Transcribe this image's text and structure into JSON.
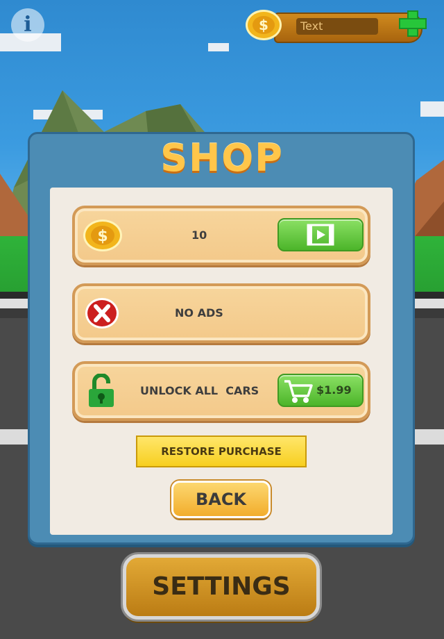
{
  "hud": {
    "currency_text": "Text",
    "info_symbol": "i",
    "coin_symbol": "$"
  },
  "shop": {
    "title": "SHOP",
    "items": [
      {
        "label": "10",
        "icon": "coin-icon",
        "action_icon": "video-play-icon"
      },
      {
        "label": "NO ADS",
        "icon": "no-ads-x-icon"
      },
      {
        "label": "UNLOCK ALL  CARS",
        "icon": "unlock-padlock-icon",
        "price": "$1.99",
        "action_icon": "cart-icon"
      }
    ],
    "restore_label": "RESTORE PURCHASE",
    "back_label": "BACK"
  },
  "settings_label": "SETTINGS",
  "colors": {
    "title": "#ffc64a",
    "panel": "#4c8cb4",
    "green_button": "#4cb52a",
    "restore_button": "#f7cf20",
    "settings_button": "#bb7c14"
  }
}
